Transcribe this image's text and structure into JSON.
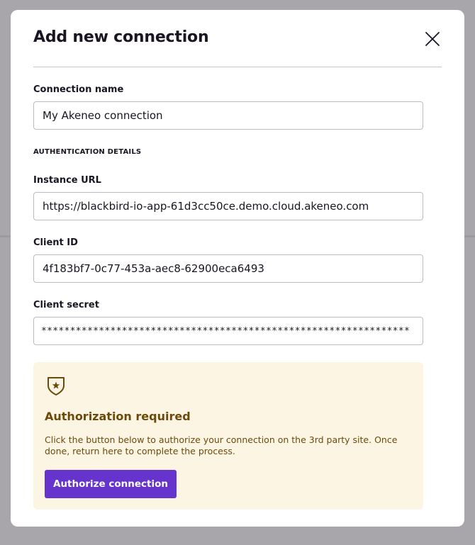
{
  "modal": {
    "title": "Add new connection",
    "close_icon": "close-icon"
  },
  "connection_name": {
    "label": "Connection name",
    "value": "My Akeneo connection"
  },
  "auth_section": {
    "label": "AUTHENTICATION DETAILS"
  },
  "instance_url": {
    "label": "Instance URL",
    "value": "https://blackbird-io-app-61d3cc50ce.demo.cloud.akeneo.com"
  },
  "client_id": {
    "label": "Client ID",
    "value": "4f183bf7-0c77-453a-aec8-62900eca6493"
  },
  "client_secret": {
    "label": "Client secret",
    "value": "****************************************************************"
  },
  "authorization": {
    "icon": "shield-star-icon",
    "title": "Authorization required",
    "description": "Click the button below to authorize your connection on the 3rd party site. Once done, return here to complete the process.",
    "button_label": "Authorize connection",
    "accent_color": "#6633cc",
    "background_color": "#fdf5e4",
    "text_color": "#6b4a0a"
  }
}
